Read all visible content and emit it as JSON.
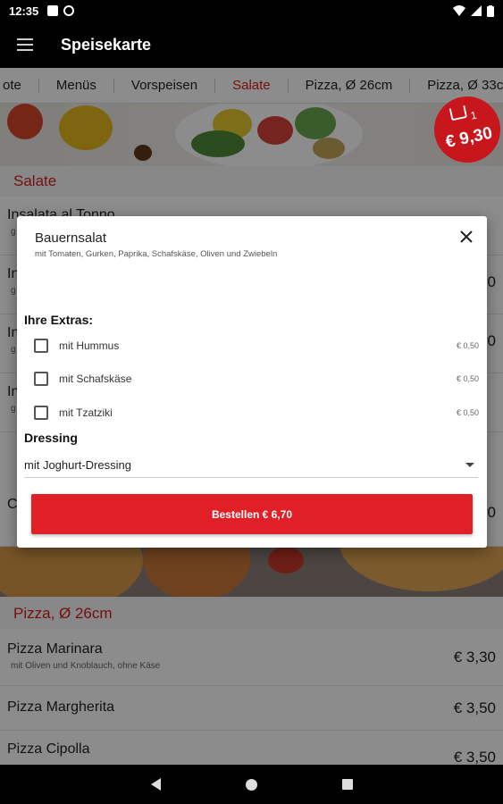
{
  "status": {
    "time": "12:35"
  },
  "appbar": {
    "title": "Speisekarte"
  },
  "tabs": [
    {
      "label": "ote"
    },
    {
      "label": "Menüs"
    },
    {
      "label": "Vorspeisen"
    },
    {
      "label": "Salate",
      "active": true
    },
    {
      "label": "Pizza, Ø 26cm"
    },
    {
      "label": "Pizza, Ø 33c"
    }
  ],
  "cart": {
    "count": "1",
    "total": "€ 9,30"
  },
  "sections": {
    "salate": {
      "title": "Salate",
      "items": [
        {
          "name": "Insalata al Tonno",
          "desc": "g",
          "price": ""
        },
        {
          "name": "In",
          "desc": "g",
          "price": "0"
        },
        {
          "name": "In",
          "desc": "g",
          "price": "0"
        },
        {
          "name": "In",
          "desc": "g",
          "price": ""
        },
        {
          "name": "C",
          "desc": "",
          "price": "0"
        }
      ]
    },
    "pizza26": {
      "title": "Pizza, Ø 26cm",
      "items": [
        {
          "name": "Pizza Marinara",
          "desc": "mit Oliven und Knoblauch, ohne Käse",
          "price": "€ 3,30"
        },
        {
          "name": "Pizza Margherita",
          "desc": "",
          "price": "€ 3,50"
        },
        {
          "name": "Pizza Cipolla",
          "desc": "",
          "price": "€ 3,50"
        }
      ]
    }
  },
  "dialog": {
    "title": "Bauernsalat",
    "subtitle": "mit Tomaten, Gurken, Paprika, Schafskäse, Oliven und Zwiebeln",
    "extras_heading": "Ihre Extras:",
    "extras": [
      {
        "label": "mit Hummus",
        "price": "€ 0,50",
        "checked": false
      },
      {
        "label": "mit Schafskäse",
        "price": "€ 0,50",
        "checked": false
      },
      {
        "label": "mit Tzatziki",
        "price": "€ 0,50",
        "checked": false
      }
    ],
    "dressing_heading": "Dressing",
    "dressing_selected": "mit Joghurt-Dressing",
    "order_button": "Bestellen € 6,70"
  },
  "colors": {
    "accent": "#d51e1e",
    "button": "#e01f26",
    "bar": "#000000"
  }
}
